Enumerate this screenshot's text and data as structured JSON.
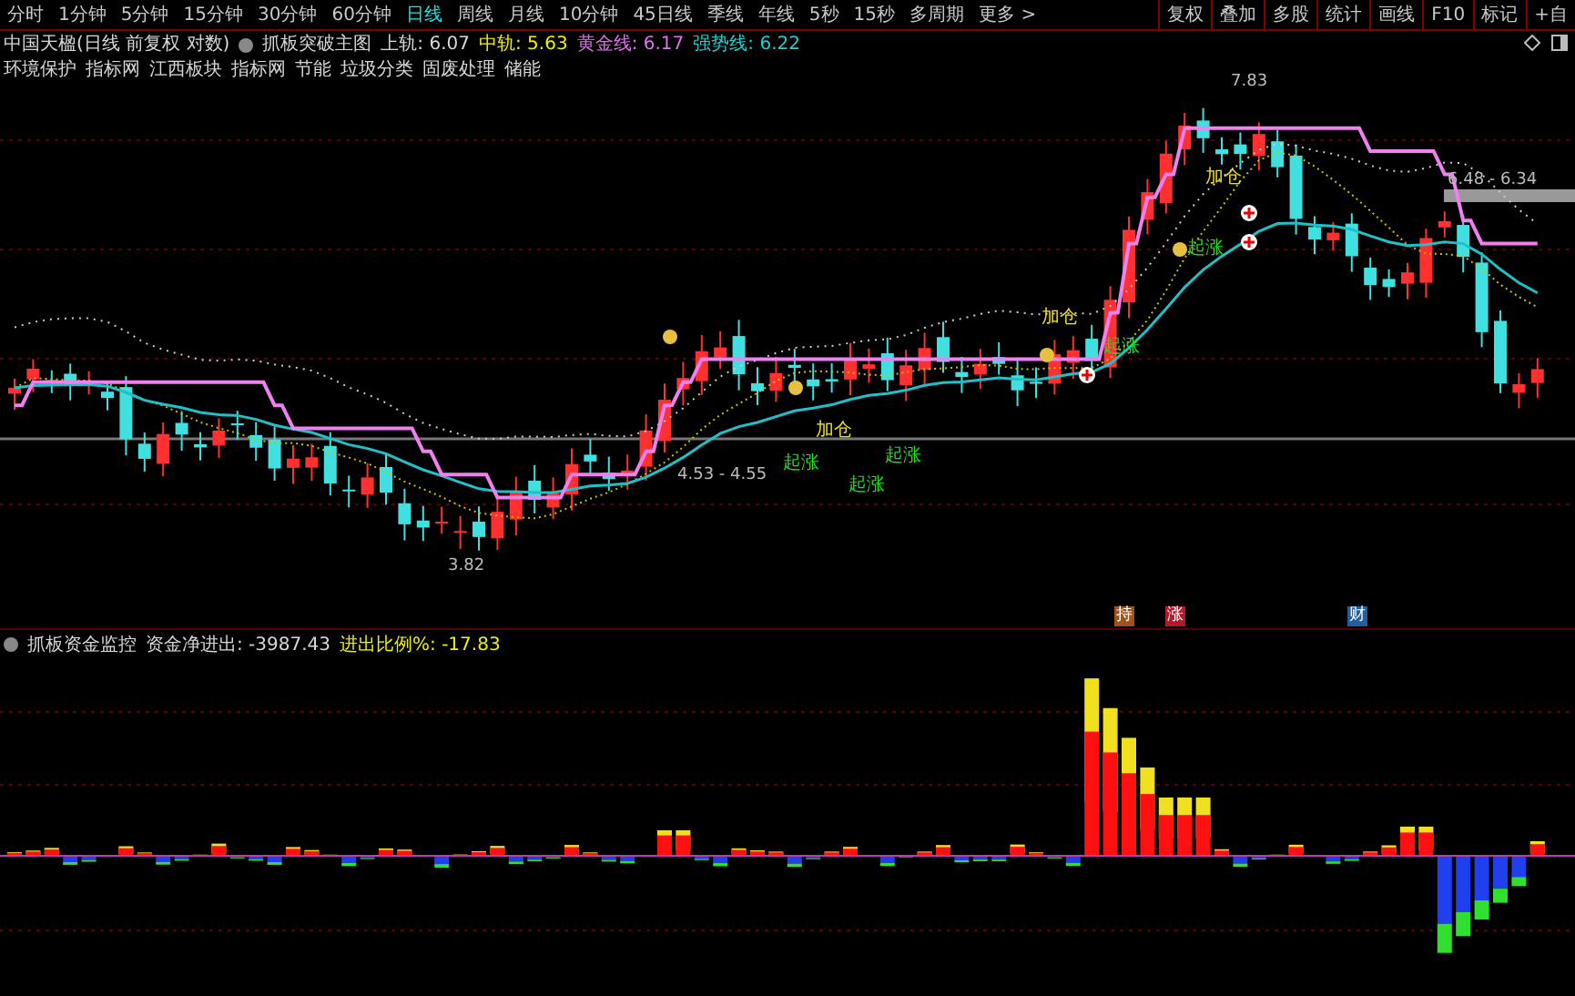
{
  "toolbar": {
    "periods": [
      {
        "label": "分时",
        "selected": false
      },
      {
        "label": "1分钟",
        "selected": false
      },
      {
        "label": "5分钟",
        "selected": false
      },
      {
        "label": "15分钟",
        "selected": false
      },
      {
        "label": "30分钟",
        "selected": false
      },
      {
        "label": "60分钟",
        "selected": false
      },
      {
        "label": "日线",
        "selected": true
      },
      {
        "label": "周线",
        "selected": false
      },
      {
        "label": "月线",
        "selected": false
      },
      {
        "label": "10分钟",
        "selected": false
      },
      {
        "label": "45日线",
        "selected": false
      },
      {
        "label": "季线",
        "selected": false
      },
      {
        "label": "年线",
        "selected": false
      },
      {
        "label": "5秒",
        "selected": false
      },
      {
        "label": "15秒",
        "selected": false
      },
      {
        "label": "多周期",
        "selected": false
      },
      {
        "label": "更多 >",
        "selected": false
      }
    ],
    "buttons": [
      "复权",
      "叠加",
      "多股",
      "统计",
      "画线",
      "F10",
      "标记",
      "+自"
    ]
  },
  "header": {
    "stock": "中国天楹(日线 前复权 对数)",
    "indicator": "抓板突破主图",
    "values": [
      {
        "label": "上轨: 6.07",
        "kind": "upper"
      },
      {
        "label": "中轨: 5.63",
        "kind": "middle"
      },
      {
        "label": "黄金线: 6.17",
        "kind": "gold"
      },
      {
        "label": "强势线: 6.22",
        "kind": "strong"
      }
    ]
  },
  "tags": [
    "环境保护",
    "指标网",
    "江西板块",
    "指标网",
    "节能",
    "垃圾分类",
    "固废处理",
    "储能"
  ],
  "main_chart": {
    "price_labels": [
      "7.83",
      "3.82",
      "4.53 - 4.55",
      "6.48 - 6.34"
    ],
    "signals": [
      {
        "label": "起涨",
        "kind": "rise"
      },
      {
        "label": "加仓",
        "kind": "add"
      },
      {
        "label": "起涨",
        "kind": "rise"
      },
      {
        "label": "起涨",
        "kind": "rise"
      },
      {
        "label": "加仓",
        "kind": "add"
      },
      {
        "label": "起涨",
        "kind": "rise"
      },
      {
        "label": "起涨",
        "kind": "rise"
      },
      {
        "label": "加仓",
        "kind": "add"
      }
    ]
  },
  "markers": [
    {
      "label": "持",
      "kind": "hold"
    },
    {
      "label": "涨",
      "kind": "up"
    },
    {
      "label": "财",
      "kind": "finance"
    }
  ],
  "sub_chart": {
    "title": "抓板资金监控",
    "values": [
      {
        "label": "资金净进出: -3987.43",
        "kind": "net"
      },
      {
        "label": "进出比例%: -17.83",
        "kind": "ratio"
      }
    ]
  }
}
